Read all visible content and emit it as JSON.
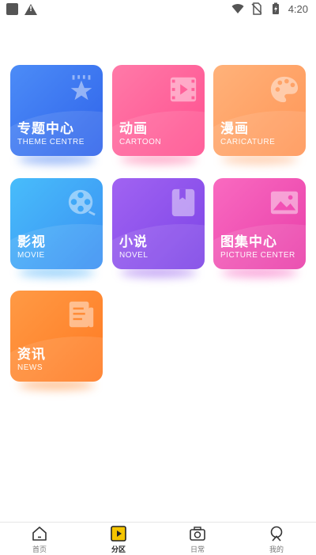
{
  "status_bar": {
    "time": "4:20",
    "icons": [
      "app-notification-icon",
      "warning-icon",
      "wifi-icon",
      "no-sim-icon",
      "battery-charging-icon"
    ]
  },
  "colors": {
    "blue": "#3b78f2",
    "pink": "#ff5f9a",
    "orange_light": "#ffa56b",
    "sky": "#3eaaf8",
    "purple": "#8f54ec",
    "magenta": "#f54fb7",
    "orange": "#ff8a33",
    "nav_active": "#f5c400"
  },
  "tiles": [
    {
      "title": "专题中心",
      "subtitle": "THEME  CENTRE",
      "icon": "star-icon"
    },
    {
      "title": "动画",
      "subtitle": "CARTOON",
      "icon": "film-icon"
    },
    {
      "title": "漫画",
      "subtitle": "CARICATURE",
      "icon": "palette-icon"
    },
    {
      "title": "影视",
      "subtitle": "MOVIE",
      "icon": "film-reel-icon"
    },
    {
      "title": "小说",
      "subtitle": "NOVEL",
      "icon": "book-icon"
    },
    {
      "title": "图集中心",
      "subtitle": "PICTURE  CENTER",
      "icon": "picture-icon"
    },
    {
      "title": "资讯",
      "subtitle": "NEWS",
      "icon": "document-icon"
    }
  ],
  "nav": {
    "items": [
      {
        "label": "首页",
        "icon": "home-icon",
        "active": false
      },
      {
        "label": "分区",
        "icon": "play-icon",
        "active": true
      },
      {
        "label": "日常",
        "icon": "camera-icon",
        "active": false
      },
      {
        "label": "我的",
        "icon": "user-icon",
        "active": false
      }
    ]
  }
}
